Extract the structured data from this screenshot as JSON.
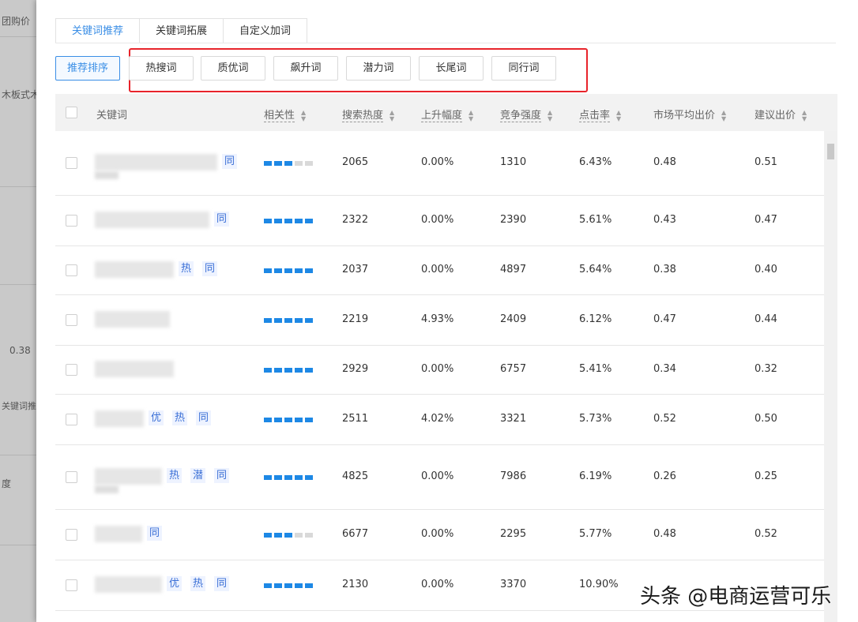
{
  "background_page": {
    "texts": [
      "团购价",
      "木板式木",
      "0.38",
      "关键词推荐",
      "度"
    ]
  },
  "tabs": [
    "关键词推荐",
    "关键词拓展",
    "自定义加词"
  ],
  "sort_button": "推荐排序",
  "filters": [
    "热搜词",
    "质优词",
    "飙升词",
    "潜力词",
    "长尾词",
    "同行词"
  ],
  "table": {
    "headers": {
      "keyword": "关键词",
      "relevance": "相关性",
      "search_heat": "搜索热度",
      "rise": "上升幅度",
      "competition": "竞争强度",
      "ctr": "点击率",
      "avg_bid": "市场平均出价",
      "suggested_bid": "建议出价"
    },
    "rows": [
      {
        "tags": [
          "同"
        ],
        "relevance": 3,
        "search_heat": "2065",
        "rise": "0.00%",
        "competition": "1310",
        "ctr": "6.43%",
        "avg_bid": "0.48",
        "suggested_bid": "0.51"
      },
      {
        "tags": [
          "同"
        ],
        "relevance": 5,
        "search_heat": "2322",
        "rise": "0.00%",
        "competition": "2390",
        "ctr": "5.61%",
        "avg_bid": "0.43",
        "suggested_bid": "0.47"
      },
      {
        "tags": [
          "热",
          "同"
        ],
        "relevance": 5,
        "search_heat": "2037",
        "rise": "0.00%",
        "competition": "4897",
        "ctr": "5.64%",
        "avg_bid": "0.38",
        "suggested_bid": "0.40"
      },
      {
        "tags": [],
        "relevance": 5,
        "search_heat": "2219",
        "rise": "4.93%",
        "competition": "2409",
        "ctr": "6.12%",
        "avg_bid": "0.47",
        "suggested_bid": "0.44"
      },
      {
        "tags": [],
        "relevance": 5,
        "search_heat": "2929",
        "rise": "0.00%",
        "competition": "6757",
        "ctr": "5.41%",
        "avg_bid": "0.34",
        "suggested_bid": "0.32"
      },
      {
        "tags": [
          "优",
          "热",
          "同"
        ],
        "relevance": 5,
        "search_heat": "2511",
        "rise": "4.02%",
        "competition": "3321",
        "ctr": "5.73%",
        "avg_bid": "0.52",
        "suggested_bid": "0.50"
      },
      {
        "tags": [
          "热",
          "潜",
          "同"
        ],
        "relevance": 5,
        "search_heat": "4825",
        "rise": "0.00%",
        "competition": "7986",
        "ctr": "6.19%",
        "avg_bid": "0.26",
        "suggested_bid": "0.25"
      },
      {
        "tags": [
          "同"
        ],
        "relevance": 3,
        "search_heat": "6677",
        "rise": "0.00%",
        "competition": "2295",
        "ctr": "5.77%",
        "avg_bid": "0.48",
        "suggested_bid": "0.52"
      },
      {
        "tags": [
          "优",
          "热",
          "同"
        ],
        "relevance": 5,
        "search_heat": "2130",
        "rise": "0.00%",
        "competition": "3370",
        "ctr": "10.90%",
        "avg_bid": "",
        "suggested_bid": ""
      }
    ]
  },
  "watermark": "头条 @电商运营可乐"
}
